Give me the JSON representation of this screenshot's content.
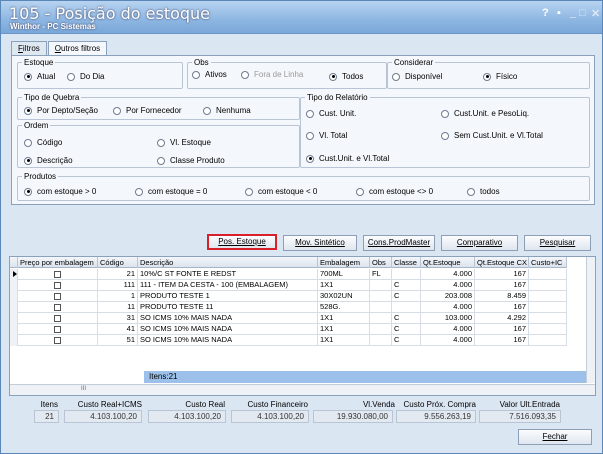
{
  "window": {
    "title": "105 - Posição do estoque",
    "subtitle": "Winthor - PC Sistemas",
    "controls": {
      "help": "?",
      "restore": "▪",
      "minimize": "_",
      "maximize": "□",
      "close": "✕"
    }
  },
  "tabs": [
    {
      "label": "Filtros",
      "accel": "F",
      "rest": "iltros"
    },
    {
      "label": "Outros filtros",
      "accel": "O",
      "rest": "utros filtros"
    }
  ],
  "estoque": {
    "legend": "Estoque",
    "options": [
      "Atual",
      "Do Dia"
    ],
    "selected": "Atual"
  },
  "obs": {
    "legend": "Obs",
    "options": [
      "Ativos",
      "Fora de Linha",
      "Todos"
    ],
    "selected": "Todos"
  },
  "considerar": {
    "legend": "Considerar",
    "options": [
      "Disponível",
      "Físico"
    ],
    "selected": "Físico"
  },
  "tipo_quebra": {
    "legend": "Tipo de Quebra",
    "options": [
      "Por Depto/Seção",
      "Por Fornecedor",
      "Nenhuma"
    ],
    "selected": "Por Depto/Seção"
  },
  "ordem": {
    "legend": "Ordem",
    "options": [
      "Código",
      "Vl. Estoque",
      "Descrição",
      "Classe Produto"
    ],
    "selected": "Descrição"
  },
  "tipo_relatorio": {
    "legend": "Tipo do Relatório",
    "options": [
      "Cust. Unit.",
      "Cust.Unit. e PesoLiq.",
      "Vl. Total",
      "Sem Cust.Unit. e Vl.Total",
      "Cust.Unit. e Vl.Total"
    ],
    "selected": "Cust.Unit. e Vl.Total"
  },
  "produtos": {
    "legend": "Produtos",
    "options": [
      "com estoque > 0",
      "com estoque = 0",
      "com estoque < 0",
      "com estoque <> 0",
      "todos"
    ],
    "selected": "com estoque > 0"
  },
  "buttons": {
    "pos_estoque": "Pos. Estoque",
    "mov_sintetico": "Mov. Sintético",
    "cons_prodmaster": "Cons.ProdMaster",
    "comparativo": "Comparativo",
    "pesquisar": "Pesquisar",
    "fechar": "Fechar"
  },
  "grid": {
    "columns": [
      "Preço por embalagem",
      "Código",
      "Descrição",
      "Embalagem",
      "Obs",
      "Classe",
      "Qt.Estoque",
      "Qt.Estoque CX",
      "Custo+IC"
    ],
    "rows": [
      {
        "codigo": "21",
        "descricao": "10%/C ST FONTE E REDST",
        "embalagem": "700ML",
        "obs": "FL",
        "classe": "",
        "qt_estoque": "4.000",
        "qt_cx": "167"
      },
      {
        "codigo": "111",
        "descricao": "111 - ITEM DA CESTA - 100 (EMBALAGEM)",
        "embalagem": "1X1",
        "obs": "",
        "classe": "C",
        "qt_estoque": "4.000",
        "qt_cx": "167"
      },
      {
        "codigo": "1",
        "descricao": "PRODUTO TESTE 1",
        "embalagem": "30X02UN",
        "obs": "",
        "classe": "C",
        "qt_estoque": "203.008",
        "qt_cx": "8.459"
      },
      {
        "codigo": "11",
        "descricao": "PRODUTO TESTE 11",
        "embalagem": "528G.",
        "obs": "",
        "classe": "",
        "qt_estoque": "4.000",
        "qt_cx": "167"
      },
      {
        "codigo": "31",
        "descricao": "SO ICMS 10% MAIS NADA",
        "embalagem": "1X1",
        "obs": "",
        "classe": "C",
        "qt_estoque": "103.000",
        "qt_cx": "4.292"
      },
      {
        "codigo": "41",
        "descricao": "SO ICMS 10% MAIS NADA",
        "embalagem": "1X1",
        "obs": "",
        "classe": "C",
        "qt_estoque": "4.000",
        "qt_cx": "167"
      },
      {
        "codigo": "51",
        "descricao": "SO ICMS 10% MAIS NADA",
        "embalagem": "1X1",
        "obs": "",
        "classe": "C",
        "qt_estoque": "4.000",
        "qt_cx": "167"
      }
    ],
    "summary": "Itens:21",
    "scroll_marker": "III"
  },
  "totals": {
    "itens": {
      "label": "Itens",
      "value": "21"
    },
    "custo_real_icms": {
      "label": "Custo Real+ICMS",
      "value": "4.103.100,20"
    },
    "custo_real": {
      "label": "Custo Real",
      "value": "4.103.100,20"
    },
    "custo_financeiro": {
      "label": "Custo Financeiro",
      "value": "4.103.100,20"
    },
    "vl_venda": {
      "label": "Vl.Venda",
      "value": "19.930.080,00"
    },
    "custo_prox_compra": {
      "label": "Custo Próx. Compra",
      "value": "9.556.263,19"
    },
    "valor_ult_entrada": {
      "label": "Valor Ult.Entrada",
      "value": "7.516.093,35"
    }
  }
}
